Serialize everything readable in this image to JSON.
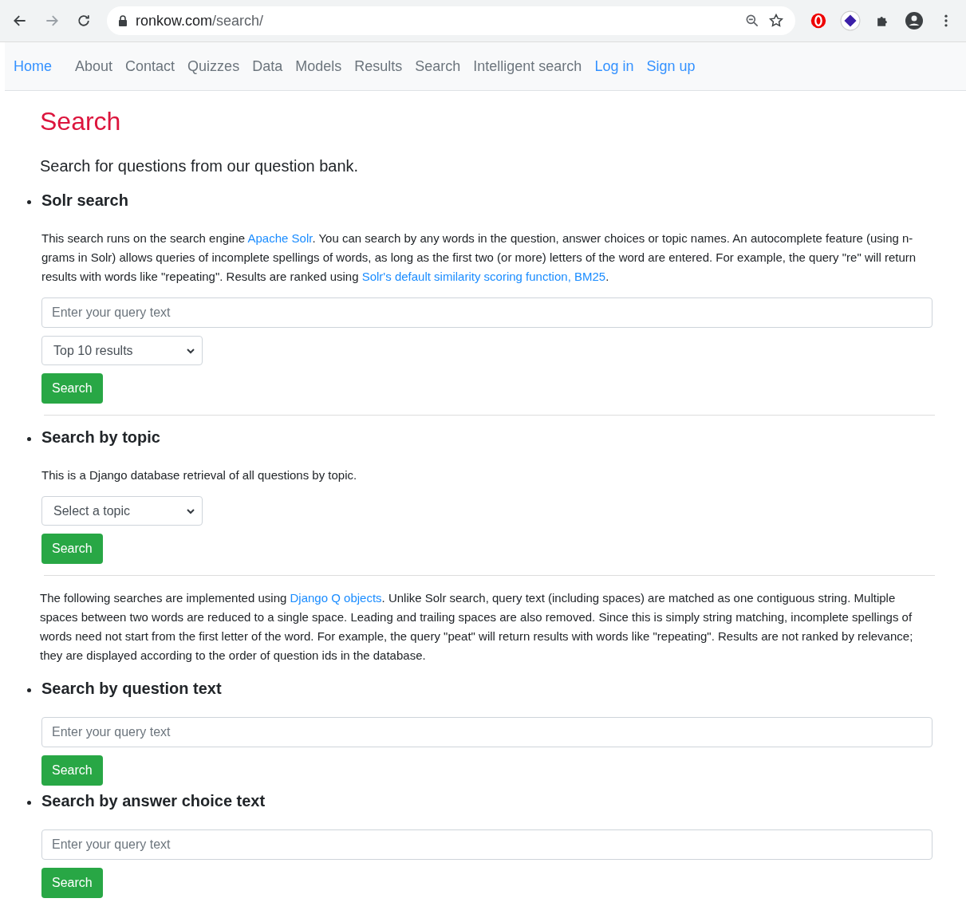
{
  "browser": {
    "url_host": "ronkow.com",
    "url_path": "/search/"
  },
  "nav": [
    {
      "label": "Home",
      "kind": "link"
    },
    {
      "label": "About",
      "kind": "plain"
    },
    {
      "label": "Contact",
      "kind": "plain"
    },
    {
      "label": "Quizzes",
      "kind": "plain"
    },
    {
      "label": "Data",
      "kind": "plain"
    },
    {
      "label": "Models",
      "kind": "plain"
    },
    {
      "label": "Results",
      "kind": "plain"
    },
    {
      "label": "Search",
      "kind": "plain"
    },
    {
      "label": "Intelligent search",
      "kind": "plain"
    },
    {
      "label": "Log in",
      "kind": "link"
    },
    {
      "label": "Sign up",
      "kind": "link"
    }
  ],
  "page": {
    "title": "Search",
    "intro": "Search for questions from our question bank."
  },
  "blocks": [
    {
      "kind": "section",
      "heading": "Solr search",
      "description": [
        {
          "text": "This search runs on the search engine "
        },
        {
          "link": "Apache Solr"
        },
        {
          "text": ". You can search by any words in the question, answer choices or topic names. An autocomplete feature (using n-grams in Solr) allows queries of incomplete spellings of words, as long as the first two (or more) letters of the word are entered. For example, the query \"re\" will return results with words like \"repeating\". Results are ranked using "
        },
        {
          "link": "Solr's default similarity scoring function, BM25"
        },
        {
          "text": "."
        }
      ],
      "controls": [
        {
          "kind": "input",
          "placeholder": "Enter your query text"
        },
        {
          "kind": "select",
          "value": "Top 10 results"
        },
        {
          "kind": "button",
          "label": "Search"
        }
      ]
    },
    {
      "kind": "divider"
    },
    {
      "kind": "section",
      "heading": "Search by topic",
      "description": [
        {
          "text": "This is a Django database retrieval of all questions by topic."
        }
      ],
      "controls": [
        {
          "kind": "select",
          "value": "Select a topic"
        },
        {
          "kind": "button",
          "label": "Search"
        }
      ]
    },
    {
      "kind": "divider"
    },
    {
      "kind": "note",
      "description": [
        {
          "text": "The following searches are implemented using "
        },
        {
          "link": "Django Q objects"
        },
        {
          "text": ". Unlike Solr search, query text (including spaces) are matched as one contiguous string. Multiple spaces between two words are reduced to a single space. Leading and trailing spaces are also removed. Since this is simply string matching, incomplete spellings of words need not start from the first letter of the word. For example, the query \"peat\" will return results with words like \"repeating\". Results are not ranked by relevance; they are displayed according to the order of question ids in the database."
        }
      ]
    },
    {
      "kind": "section",
      "heading": "Search by question text",
      "controls": [
        {
          "kind": "input",
          "placeholder": "Enter your query text"
        },
        {
          "kind": "button",
          "label": "Search"
        }
      ]
    },
    {
      "kind": "section",
      "heading": "Search by answer choice text",
      "controls": [
        {
          "kind": "input",
          "placeholder": "Enter your query text"
        },
        {
          "kind": "button",
          "label": "Search"
        }
      ]
    }
  ]
}
